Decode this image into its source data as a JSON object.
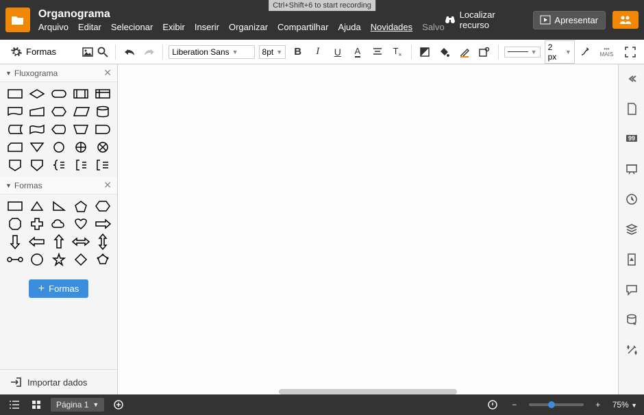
{
  "header": {
    "title": "Organograma",
    "menus": [
      "Arquivo",
      "Editar",
      "Selecionar",
      "Exibir",
      "Inserir",
      "Organizar",
      "Compartilhar",
      "Ajuda",
      "Novidades",
      "Salvo"
    ],
    "recording_hint": "Ctrl+Shift+6 to start recording",
    "find_resource": "Localizar recurso",
    "present": "Apresentar"
  },
  "toolbar": {
    "font": "Liberation Sans",
    "font_size": "8pt",
    "stroke_width": "2 px",
    "more": "MAIS"
  },
  "sidebar": {
    "label": "Formas",
    "cat1": "Fluxograma",
    "cat2": "Formas",
    "more_shapes": "Formas",
    "import": "Importar dados"
  },
  "footer": {
    "page": "Página 1",
    "zoom": "75%"
  }
}
